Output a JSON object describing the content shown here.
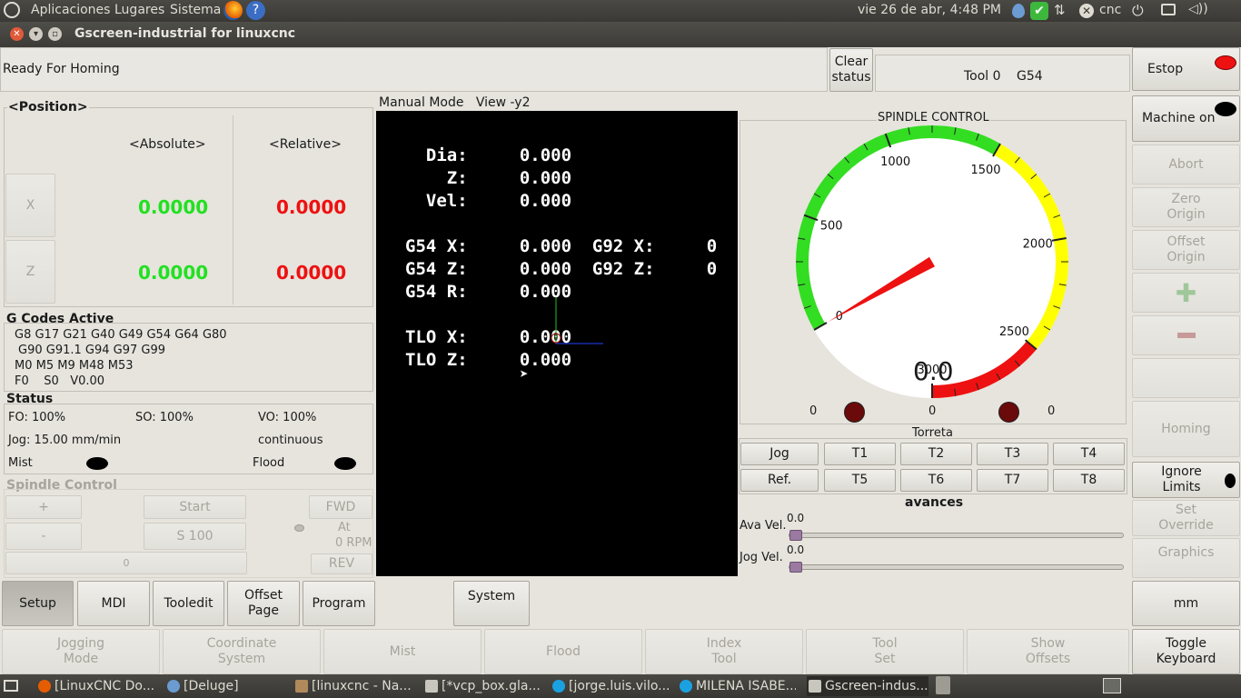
{
  "top_panel": {
    "menus": [
      "Aplicaciones",
      "Lugares",
      "Sistema"
    ],
    "clock": "vie 26 de abr,  4:48 PM",
    "user": "cnc"
  },
  "window": {
    "title": "Gscreen-industrial for linuxcnc"
  },
  "status_bar": {
    "message": "Ready For Homing",
    "clear_label": "Clear status",
    "tool": "Tool 0",
    "coord": "G54"
  },
  "right_buttons": {
    "estop": "Estop",
    "machine_on": "Machine on",
    "abort": "Abort",
    "zero_origin": "Zero Origin",
    "offset_origin": "Offset Origin",
    "homing": "Homing",
    "ignore_limits": "Ignore Limits",
    "set_override": "Set Override",
    "graphics": "Graphics",
    "units": "mm",
    "toggle_keyboard": "Toggle Keyboard"
  },
  "position": {
    "title": "<Position>",
    "absolute_header": "<Absolute>",
    "relative_header": "<Relative>",
    "axes": [
      {
        "name": "X",
        "absolute": "0.0000",
        "relative": "0.0000"
      },
      {
        "name": "Z",
        "absolute": "0.0000",
        "relative": "0.0000"
      }
    ]
  },
  "gcodes": {
    "title": "G Codes Active",
    "line1": "G8 G17 G21 G40 G49 G54 G64 G80",
    "line2": "G90 G91.1 G94 G97 G99",
    "line3": "M0 M5 M9 M48 M53",
    "line4": "F0    S0   V0.00"
  },
  "status": {
    "title": "Status",
    "fo": "FO: 100%",
    "so": "SO: 100%",
    "vo": "VO: 100%",
    "jog": "Jog: 15.00 mm/min",
    "jog_mode": "continuous",
    "mist": "Mist",
    "flood": "Flood"
  },
  "spindle_control_left": {
    "title": "Spindle Control",
    "plus": "+",
    "minus": "-",
    "start": "Start",
    "s100": "S 100",
    "fwd": "FWD",
    "rev": "REV",
    "at_rpm_line1": "At",
    "at_rpm_line2": "0 RPM",
    "bar_value": "0"
  },
  "preview": {
    "header": "Manual Mode   View -y2",
    "lines": [
      "  Dia:     0.000",
      "    Z:     0.000",
      "  Vel:     0.000",
      "",
      "G54 X:     0.000  G92 X:     0",
      "G54 Z:     0.000  G92 Z:     0",
      "G54 R:     0.000",
      "",
      "TLO X:     0.000",
      "TLO Z:     0.000"
    ]
  },
  "spindle_gauge": {
    "title": "SPINDLE CONTROL",
    "min": 0,
    "max": 3000,
    "value": 0.0,
    "value_text": "0.0",
    "tick_labels": [
      "0",
      "500",
      "1000",
      "1500",
      "2000",
      "2500",
      "3000"
    ],
    "zones": {
      "green": "#33dd22",
      "yellow": "#ffff00",
      "red": "#ee1111"
    },
    "left_count": "0",
    "center_count": "0",
    "right_count": "0"
  },
  "torreta": {
    "title": "Torreta",
    "row1": [
      "Jog",
      "T1",
      "T2",
      "T3",
      "T4"
    ],
    "row2": [
      "Ref.",
      "T5",
      "T6",
      "T7",
      "T8"
    ]
  },
  "avances": {
    "title": "avances",
    "ava_label": "Ava Vel.",
    "ava_value": "0.0",
    "jog_label": "Jog Vel.",
    "jog_value": "0.0"
  },
  "bottom_tabs": [
    "Setup",
    "MDI",
    "Tooledit",
    "Offset Page",
    "Program",
    "System"
  ],
  "bottom_actions": [
    "Jogging Mode",
    "Coordinate System",
    "Mist",
    "Flood",
    "Index Tool",
    "Tool Set",
    "Show Offsets"
  ],
  "taskbar": [
    "[LinuxCNC Do...",
    "[Deluge]",
    "[linuxcnc - Na...",
    "[*vcp_box.gla...",
    "[jorge.luis.vilo...",
    "MILENA ISABE...",
    "Gscreen-indus..."
  ]
}
